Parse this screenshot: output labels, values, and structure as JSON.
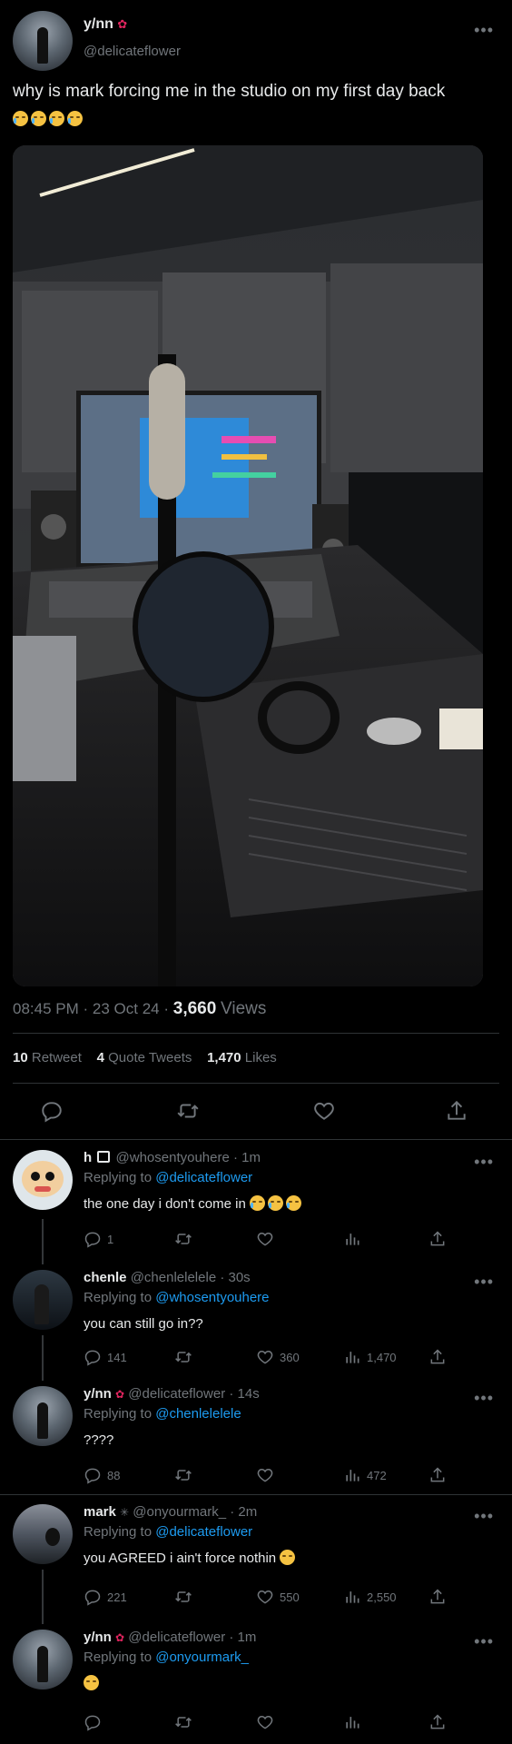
{
  "tweet": {
    "author_name": "y/nn",
    "author_handle": "@delicateflower",
    "text": "why is mark forcing me in the studio on my first day back",
    "emoji_count": 4,
    "time": "08:45 PM",
    "date": "23 Oct 24",
    "views_count": "3,660",
    "views_label": "Views",
    "retweets_count": "10",
    "retweets_label": "Retweet",
    "quotes_count": "4",
    "quotes_label": "Quote Tweets",
    "likes_count": "1,470",
    "likes_label": "Likes",
    "separator": "·"
  },
  "colors": {
    "background": "#000000",
    "text": "#e7e9ea",
    "muted": "#71767b",
    "link": "#1d9bf0",
    "divider": "#2f3336"
  },
  "replies": [
    {
      "name": "h",
      "locked": true,
      "handle": "@whosentyouhere",
      "age": "1m",
      "replying_label": "Replying to",
      "replying_to": "@delicateflower",
      "text": "the one day i don't come in",
      "emoji_after": 3,
      "counts": {
        "reply": "1",
        "retweet": "",
        "like": "",
        "views": ""
      }
    },
    {
      "name": "chenle",
      "handle": "@chenlelelele",
      "age": "30s",
      "replying_label": "Replying to",
      "replying_to": "@whosentyouhere",
      "text": "you can still go in??",
      "counts": {
        "reply": "141",
        "retweet": "",
        "like": "360",
        "views": "1,470"
      }
    },
    {
      "name": "y/nn",
      "handle": "@delicateflower",
      "age": "14s",
      "replying_label": "Replying to",
      "replying_to": "@chenlelelele",
      "text": "????",
      "counts": {
        "reply": "88",
        "retweet": "",
        "like": "",
        "views": "472"
      }
    },
    {
      "name": "mark",
      "handle": "@onyourmark_",
      "age": "2m",
      "replying_label": "Replying to",
      "replying_to": "@delicateflower",
      "text": "you AGREED i ain't force nothin",
      "emoji_after": 1,
      "counts": {
        "reply": "221",
        "retweet": "",
        "like": "550",
        "views": "2,550"
      }
    },
    {
      "name": "y/nn",
      "handle": "@delicateflower",
      "age": "1m",
      "replying_label": "Replying to",
      "replying_to": "@onyourmark_",
      "text": "",
      "emoji_after": 1,
      "counts": {
        "reply": "",
        "retweet": "",
        "like": "",
        "views": ""
      }
    }
  ]
}
